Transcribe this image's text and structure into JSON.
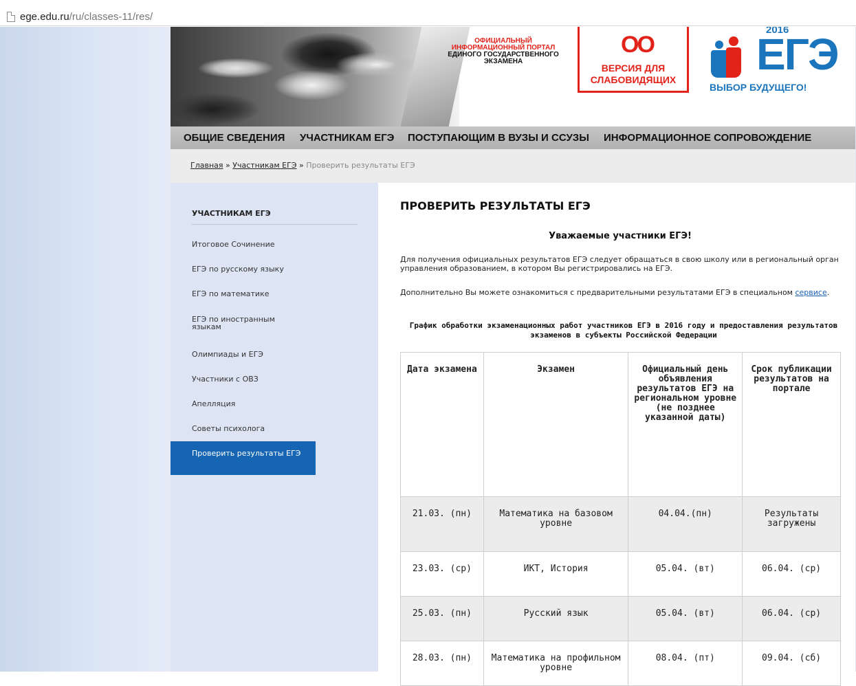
{
  "browser": {
    "url_host": "ege.edu.ru",
    "url_path": "/ru/classes-11/res/"
  },
  "header": {
    "portal_title_lines": [
      "ОФИЦИАЛЬНЫЙ",
      "ИНФОРМАЦИОННЫЙ ПОРТАЛ",
      "ЕДИНОГО ГОСУДАРСТВЕННОГО",
      "ЭКЗАМЕНА"
    ],
    "vision_glyph": "OO",
    "vision_label_1": "ВЕРСИЯ ДЛЯ",
    "vision_label_2": "СЛАБОВИДЯЩИХ",
    "logo_year": "2016",
    "logo_text": "ЕГЭ",
    "logo_slogan": "ВЫБОР БУДУЩЕГО!",
    "colors": {
      "red": "#e2231a",
      "blue": "#1b75bc"
    }
  },
  "topnav": [
    "ОБЩИЕ СВЕДЕНИЯ",
    "УЧАСТНИКАМ ЕГЭ",
    "ПОСТУПАЮЩИМ В ВУЗЫ И ССУЗЫ",
    "ИНФОРМАЦИОННОЕ СОПРОВОЖДЕНИЕ"
  ],
  "breadcrumb": {
    "home": "Главная",
    "sep": "»",
    "section": "Участникам ЕГЭ",
    "current": "Проверить результаты ЕГЭ"
  },
  "sidebar": {
    "title": "УЧАСТНИКАМ ЕГЭ",
    "items": [
      "Итоговое Сочинение",
      "ЕГЭ по русскому языку",
      "ЕГЭ по математике",
      "ЕГЭ по иностранным языкам",
      "Олимпиады и ЕГЭ",
      "Участники с ОВЗ",
      "Апелляция",
      "Советы психолога",
      "Проверить результаты ЕГЭ"
    ],
    "active_index": 8,
    "active_color": "#1565b3"
  },
  "content": {
    "title": "ПРОВЕРИТЬ РЕЗУЛЬТАТЫ ЕГЭ",
    "greeting": "Уважаемые участники ЕГЭ!",
    "para1": "Для получения официальных результатов ЕГЭ следует обращаться в свою школу или в региональный орган управления образованием, в котором Вы регистрировались на ЕГЭ.",
    "para2_text": "Дополнительно Вы можете ознакомиться с предварительными результатами ЕГЭ в специальном",
    "para2_link": "сервисе",
    "para2_end": ".",
    "table_caption": "График обработки экзаменационных работ участников ЕГЭ в 2016 году и предоставления результатов экзаменов в субъекты Российской Федерации",
    "table": {
      "headers": [
        "Дата экзамена",
        "Экзамен",
        "Официальный день объявления результатов ЕГЭ на региональном уровне (не позднее указанной даты)",
        "Срок публикации результатов на портале"
      ],
      "rows": [
        [
          "21.03. (пн)",
          "Математика на базовом уровне",
          "04.04.(пн)",
          "Результаты загружены"
        ],
        [
          "23.03. (ср)",
          "ИКТ, История",
          "05.04. (вт)",
          "06.04. (ср)"
        ],
        [
          "25.03. (пн)",
          "Русский язык",
          "05.04. (вт)",
          "06.04. (ср)"
        ],
        [
          "28.03. (пн)",
          "Математика на профильном уровне",
          "08.04. (пт)",
          "09.04. (сб)"
        ]
      ]
    }
  }
}
